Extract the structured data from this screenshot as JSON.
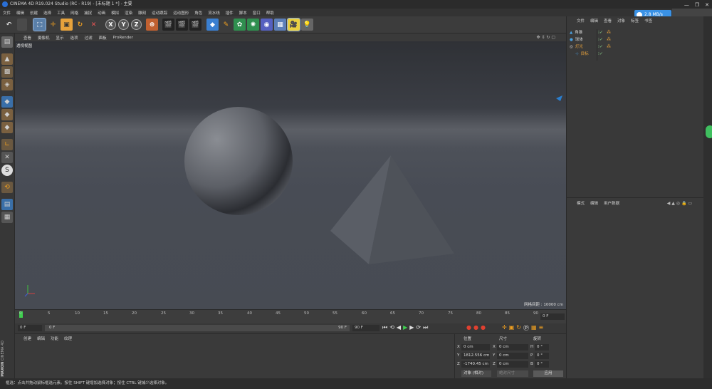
{
  "window": {
    "title": "CINEMA 4D R19.024 Studio (RC - R19) - [未标题 1 *] - 主要",
    "controls": [
      "—",
      "❐",
      "✕"
    ]
  },
  "menubar": [
    "文件",
    "编辑",
    "创建",
    "选择",
    "工具",
    "网格",
    "捕捉",
    "动画",
    "模拟",
    "渲染",
    "雕刻",
    "运动跟踪",
    "运动图形",
    "角色",
    "流水线",
    "插件",
    "脚本",
    "窗口",
    "帮助"
  ],
  "speed_badge": "2.8 MB/s",
  "viewport_menu": [
    "查看",
    "摄像机",
    "显示",
    "选项",
    "过滤",
    "面板",
    "ProRender"
  ],
  "viewport": {
    "label": "透视视图",
    "grid_spacing": "网格间距 : 10000 cm"
  },
  "timeline": {
    "ticks": [
      "0",
      "5",
      "10",
      "15",
      "20",
      "25",
      "30",
      "35",
      "40",
      "45",
      "50",
      "55",
      "60",
      "65",
      "70",
      "75",
      "80",
      "85",
      "90"
    ],
    "current_frame": "0 F"
  },
  "playbar": {
    "start": "0 F",
    "range_start": "0 F",
    "range_end": "90 F",
    "end": "90 F"
  },
  "material_menu": [
    "创建",
    "编辑",
    "功能",
    "纹理"
  ],
  "object_manager": {
    "menu": [
      "文件",
      "编辑",
      "查看",
      "对象",
      "标签",
      "书签"
    ],
    "objects": [
      {
        "name": "角锥",
        "color": "#cfcfcf"
      },
      {
        "name": "球体",
        "color": "#cfcfcf"
      },
      {
        "name": "灯光",
        "color": "#e6a23c"
      },
      {
        "name": "目标",
        "color": "#e6a23c"
      }
    ]
  },
  "attribute_manager": {
    "menu": [
      "模式",
      "编辑",
      "用户数据"
    ]
  },
  "coordinates": {
    "headers": [
      "位置",
      "尺寸",
      "旋转"
    ],
    "rows": [
      {
        "a": "X",
        "av": "0 cm",
        "b": "X",
        "bv": "0 cm",
        "c": "H",
        "cv": "0 °"
      },
      {
        "a": "Y",
        "av": "1812.556 cm",
        "b": "Y",
        "bv": "0 cm",
        "c": "P",
        "cv": "0 °"
      },
      {
        "a": "Z",
        "av": "-1740.45 cm",
        "b": "Z",
        "bv": "0 cm",
        "c": "B",
        "cv": "0 °"
      }
    ],
    "mode_select": "对象 (相对)",
    "size_select": "绝对尺寸",
    "apply_button": "应用"
  },
  "brand": {
    "line1": "MAXON",
    "line2": "CINEMA 4D"
  },
  "status_text": "框选：点击并拖动鼠标框选元素。按住 SHIFT 键增加选择对象；按住 CTRL 键减少选择对象。"
}
